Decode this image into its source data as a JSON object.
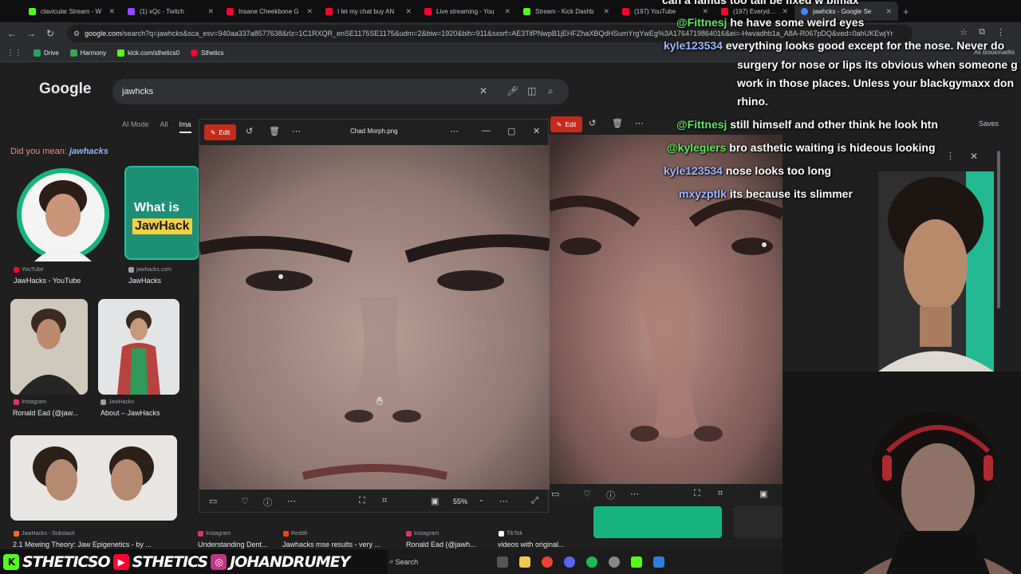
{
  "browser": {
    "tabs": [
      {
        "label": "clavicular Stream - W",
        "color": "#53fc18"
      },
      {
        "label": "(1) xQc - Twitch",
        "color": "#9146ff"
      },
      {
        "label": "Insane Cheekbone G",
        "color": "#ff0033"
      },
      {
        "label": "I let my chat buy AN",
        "color": "#ff0033"
      },
      {
        "label": "Live streaming - You",
        "color": "#ff0033"
      },
      {
        "label": "Stream - Kick Dashb",
        "color": "#53fc18"
      },
      {
        "label": "(197) YouTube",
        "color": "#ff0033"
      },
      {
        "label": "(197) Everyday Kore",
        "color": "#ff0033"
      },
      {
        "label": "jawhcks - Google Se",
        "color": "#4285f4"
      }
    ],
    "url_host": "google.com",
    "url_path": "/search?q=jawhcks&sca_esv=940aa337a8577638&rlz=1C1RXQR_enSE1175SE1175&udm=2&biw=1920&bih=911&sxsrf=AE3TifPNwpB1jEHFZhaXBQdHSumYrgYwEg%3A1764719864016&ei=-Hwvadhb1a_A8A-R067pDQ&ved=0ahUKEwjYr",
    "bookmarks": [
      {
        "label": "Drive",
        "color": "#1fa463"
      },
      {
        "label": "Harmony",
        "color": "#34a853"
      },
      {
        "label": "kick.com/sthetics0",
        "color": "#53fc18"
      },
      {
        "label": "Sthetics",
        "color": "#ff0033"
      }
    ],
    "all_bookmarks": "All Bookmarks"
  },
  "google": {
    "logo": "Google",
    "query": "jawhcks",
    "tabs": [
      "AI Mode",
      "All",
      "Ima"
    ],
    "did_you_mean_prefix": "Did you mean: ",
    "did_you_mean_term": "jawhacks",
    "results": [
      {
        "source": "YouTube",
        "title": "JawHacks - YouTube",
        "src_color": "#ff0033"
      },
      {
        "source": "jawhacks.com",
        "title": "JawHacks",
        "src_color": "#9aa0a6"
      },
      {
        "source": "Instagram",
        "title": "Ronald Ead (@jaw...",
        "src_color": "#e1306c"
      },
      {
        "source": "JawHacks",
        "title": "About – JawHacks",
        "src_color": "#9aa0a6"
      },
      {
        "source": "JawHacks - Substack",
        "title": "2.1 Mewing Theory: Jaw Epigenetics - by ...",
        "src_color": "#ff6719"
      },
      {
        "source": "Instagram",
        "title": "Understanding Dent...",
        "src_color": "#e1306c"
      },
      {
        "source": "Reddit",
        "title": "Jawhacks mse results - very ...",
        "src_color": "#ff4500"
      },
      {
        "source": "Instagram",
        "title": "Ronald Ead (@jawh...",
        "src_color": "#e1306c"
      },
      {
        "source": "TikTok",
        "title": "videos with original...",
        "src_color": "#ffffff"
      }
    ],
    "card_line1": "What is",
    "card_line2": "JawHack",
    "saves": "Saves"
  },
  "viewer1": {
    "edit_label": "Edit",
    "title": "Chad Morph.png",
    "zoom": "55%"
  },
  "viewer2": {
    "edit_label": "Edit"
  },
  "chat": [
    {
      "user": "@Fittnesj",
      "msg": "he have some weird eyes",
      "color": "green"
    },
    {
      "user": "kyle123534",
      "msg": "everything looks good except for the nose. Never do",
      "color": "blue"
    },
    {
      "user": "",
      "msg": "surgery for nose or lips its obvious when someone g",
      "color": "none"
    },
    {
      "user": "",
      "msg": "work in those places. Unless your blackgymaxx don",
      "color": "none"
    },
    {
      "user": "",
      "msg": "rhino.",
      "color": "none"
    },
    {
      "user": "@Fittnesj",
      "msg": "still himself and other think he look htn",
      "color": "green"
    },
    {
      "user": "@kylegiers",
      "msg": "bro asthetic waiting is hideous looking",
      "color": "green"
    },
    {
      "user": "kyle123534",
      "msg": "nose looks too long",
      "color": "blue"
    },
    {
      "user": "mxyzptlk",
      "msg": "its because its slimmer",
      "color": "blue"
    }
  ],
  "chat_top_partial": "can a famus too tall be fixed w bimax",
  "banner": {
    "kick_text": "STHETICSO",
    "yt_text": "STHETICS",
    "ig_text": "JOHANDRUMEY"
  },
  "taskbar": {
    "search": "Search"
  }
}
